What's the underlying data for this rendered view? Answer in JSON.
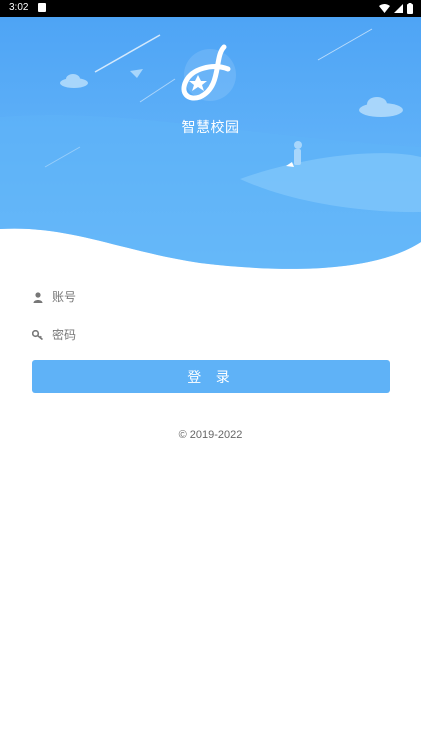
{
  "status_bar": {
    "time": "3:02"
  },
  "app": {
    "title": "智慧校园"
  },
  "form": {
    "username_placeholder": "账号",
    "password_placeholder": "密码",
    "login_label": "登 录"
  },
  "footer": {
    "copyright": "© 2019-2022"
  },
  "colors": {
    "hero_top": "#4fa6f6",
    "hero_bottom": "#7bc4fb",
    "button": "#5fb2f7",
    "status_bar": "#000000"
  },
  "icons": [
    "user-icon",
    "key-icon",
    "wifi-icon",
    "signal-icon",
    "battery-icon",
    "app-logo-icon"
  ]
}
